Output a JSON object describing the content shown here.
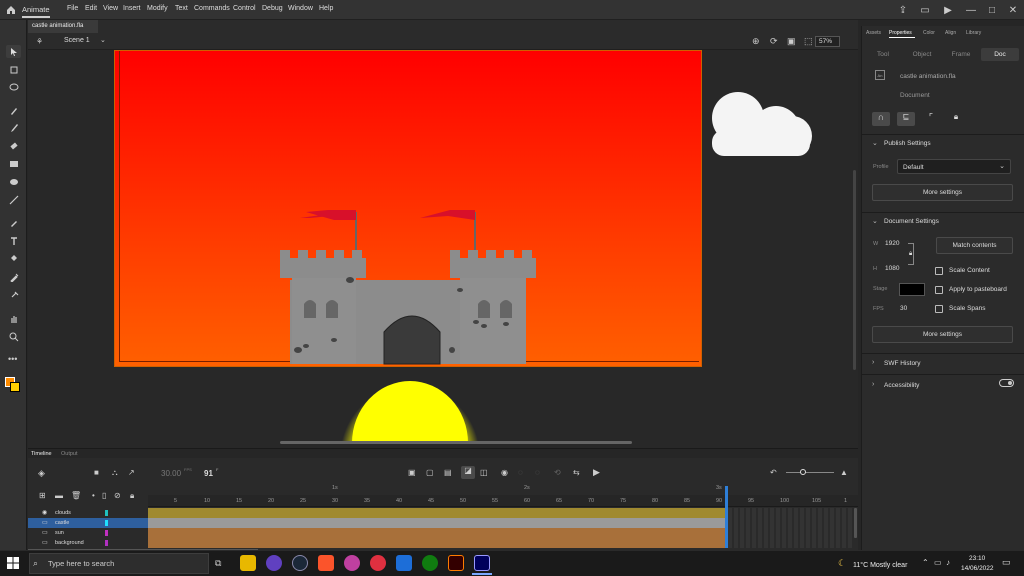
{
  "app": {
    "name": "Animate"
  },
  "menu": [
    "File",
    "Edit",
    "View",
    "Insert",
    "Modify",
    "Text",
    "Commands",
    "Control",
    "Debug",
    "Window",
    "Help"
  ],
  "document": {
    "tab_title": "castle animation.fla",
    "scene": "Scene 1",
    "zoom": "57%"
  },
  "panel": {
    "tabs": [
      "Assets",
      "Properties",
      "Color",
      "Align",
      "Library"
    ],
    "subtabs": [
      "Tool",
      "Object",
      "Frame",
      "Doc"
    ],
    "doc_name": "castle animation.fla",
    "doc_type": "Document",
    "publish_settings": {
      "title": "Publish Settings",
      "profile_label": "Profile",
      "profile_value": "Default",
      "more": "More settings"
    },
    "document_settings": {
      "title": "Document Settings",
      "w_label": "W",
      "width": "1920",
      "h_label": "H",
      "height": "1080",
      "match_button": "Match contents",
      "scale_content": "Scale Content",
      "stage_label": "Stage",
      "stage_color": "#000000",
      "apply_pasteboard": "Apply to pasteboard",
      "fps_label": "FPS",
      "fps": "30",
      "scale_spans": "Scale Spans",
      "more": "More settings"
    },
    "swf_history": "SWF History",
    "accessibility": "Accessibility"
  },
  "timeline": {
    "tabs": [
      "Timeline",
      "Output"
    ],
    "fps_display": "30.00",
    "fps_unit": "FPS",
    "frame": "91",
    "frame_unit": "F",
    "ruler_marks": [
      "5",
      "10",
      "15",
      "20",
      "25",
      "30",
      "35",
      "40",
      "45",
      "50",
      "55",
      "60",
      "65",
      "70",
      "75",
      "80",
      "85",
      "90",
      "95",
      "100",
      "105",
      "1"
    ],
    "second_marks": [
      "1s",
      "2s",
      "3s"
    ],
    "layers": [
      {
        "name": "clouds",
        "color": "#20c0c0"
      },
      {
        "name": "castle",
        "color": "#20c0e0"
      },
      {
        "name": "sun",
        "color": "#c030c0"
      },
      {
        "name": "background",
        "color": "#b030c0"
      }
    ]
  },
  "taskbar": {
    "search_placeholder": "Type here to search",
    "weather": "11°C  Mostly clear",
    "time": "23:10",
    "date": "14/06/2022"
  },
  "colors": {
    "accent": "#2e5f9e",
    "stroke": "#ff8c00",
    "fill": "#ffcc00"
  }
}
